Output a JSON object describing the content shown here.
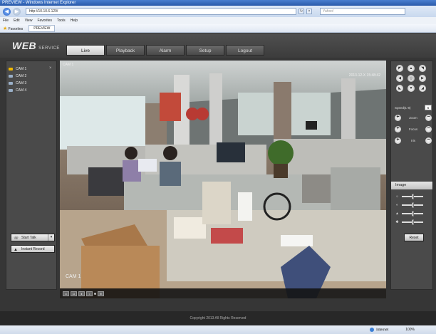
{
  "browser": {
    "title": "PREVIEW - Windows Internet Explorer",
    "url": "http://10.10.6.129/",
    "search_placeholder": "Yahoo!",
    "menu": [
      "File",
      "Edit",
      "View",
      "Favorites",
      "Tools",
      "Help"
    ],
    "favorites_label": "Favorites",
    "tab_label": "PREVIEW",
    "status_zone": "Internet",
    "zoom": "100%"
  },
  "app": {
    "logo": "WEB",
    "logo_sub": "SERVICE",
    "tabs": [
      "Live",
      "Playback",
      "Alarm",
      "Setup",
      "Logout"
    ],
    "active_tab": "Live",
    "channels": [
      "CAM 1",
      "CAM 2",
      "CAM 3",
      "CAM 4"
    ],
    "start_talk": "Start Talk",
    "instant_record": "Instant Record",
    "video": {
      "channel_label": "CAM 1",
      "osd_top_left": "CAM 1",
      "timestamp": "2013-12-X 15:48:42"
    },
    "ptz": {
      "speed_label": "Speed(1-8)",
      "speed_value": "5",
      "zoom_label": "Zoom",
      "focus_label": "Focus",
      "iris_label": "Iris"
    },
    "image_panel": {
      "title": "Image",
      "reset": "Reset",
      "sliders": [
        {
          "icon": "brightness-icon",
          "level": 0.5
        },
        {
          "icon": "contrast-icon",
          "level": 0.5
        },
        {
          "icon": "saturation-icon",
          "level": 0.5
        },
        {
          "icon": "hue-icon",
          "level": 0.5
        }
      ]
    },
    "footer": "Copyright 2013 All Rights Reserved"
  }
}
